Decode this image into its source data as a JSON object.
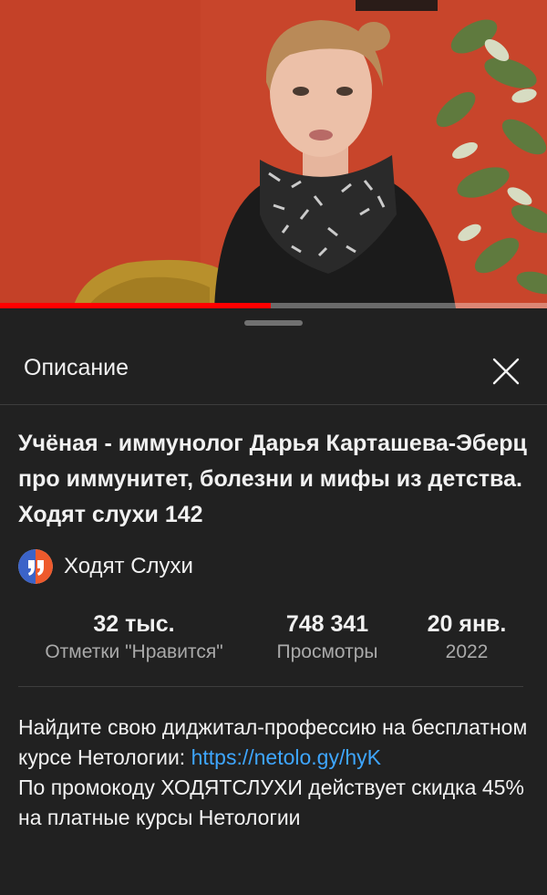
{
  "player": {
    "progress_fraction": 0.495,
    "colors": {
      "progress": "#ff0000",
      "track": "#8a8a8a",
      "wall": "#c9472d"
    }
  },
  "sheet": {
    "title": "Описание",
    "close_icon": "close-icon"
  },
  "video": {
    "title": "Учёная - иммунолог Дарья Карташева-Эберц про иммунитет, болезни и мифы из детства. Ходят слухи 142",
    "channel_name": "Ходят Слухи",
    "channel_avatar_colors": {
      "left": "#3b63c8",
      "right": "#ee5a2c"
    }
  },
  "stats": [
    {
      "value": "32 тыс.",
      "label": "Отметки \"Нравится\""
    },
    {
      "value": "748 341",
      "label": "Просмотры"
    },
    {
      "value": "20 янв.",
      "label": "2022"
    }
  ],
  "description": {
    "line1": "Найдите свою диджитал-профессию на бесплатном курсе Нетологии: ",
    "link": "https://netolo.gy/hyK",
    "line2": "По промокоду ХОДЯТСЛУХИ действует скидка 45% на платные курсы Нетологии"
  }
}
